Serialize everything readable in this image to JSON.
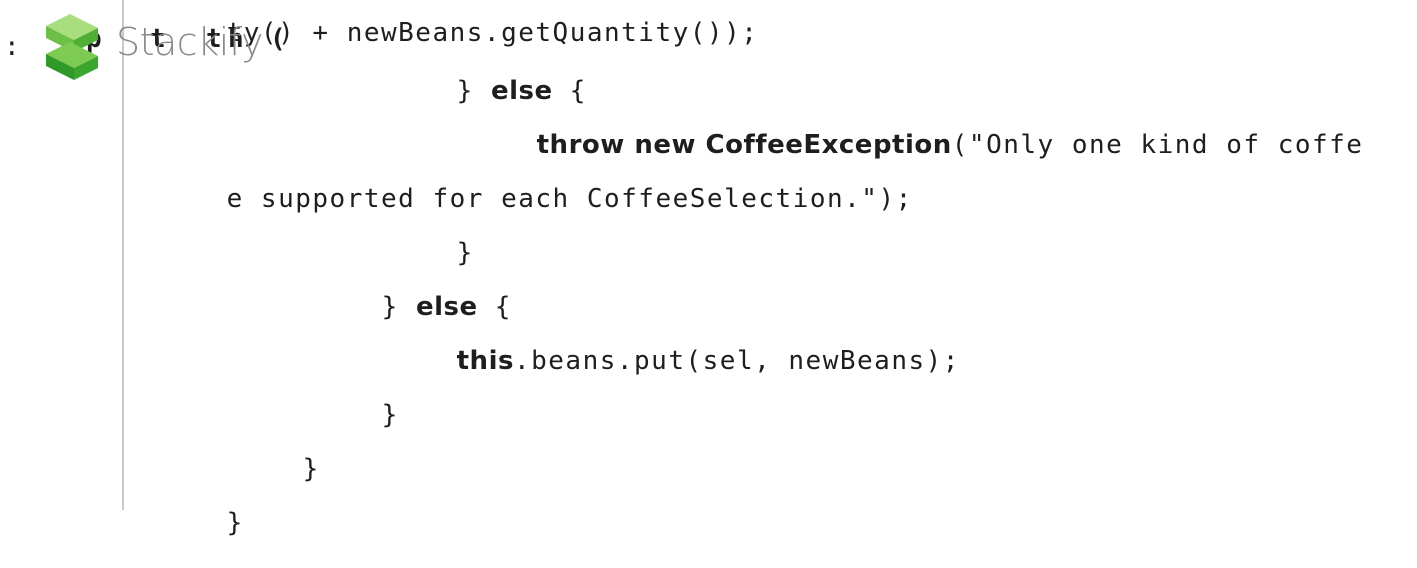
{
  "logo": {
    "prefix_char": ":",
    "brand_name": "Stackify",
    "obscured_fragments": [
      "p",
      "t",
      "t",
      "h",
      "("
    ]
  },
  "code": {
    "line1": "ty() + newBeans.getQuantity());",
    "line2_brace": "} ",
    "line2_kw": "else",
    "line2_tail": " {",
    "line3_kw": "throw new CoffeeException",
    "line3_tail": "(\"Only one kind of coffe",
    "line4": "e supported for each CoffeeSelection.\");",
    "line5": "}",
    "line6_brace": "} ",
    "line6_kw": "else",
    "line6_tail": " {",
    "line7_kw": "this",
    "line7_tail": ".beans.put(sel, newBeans);",
    "line8": "}",
    "line9": "}",
    "line10": "}"
  },
  "colors": {
    "logo_green_light": "#8cd35a",
    "logo_green_dark": "#2e9e2a",
    "brand_text": "#8a8a8a",
    "gutter": "#c8c8c8"
  }
}
